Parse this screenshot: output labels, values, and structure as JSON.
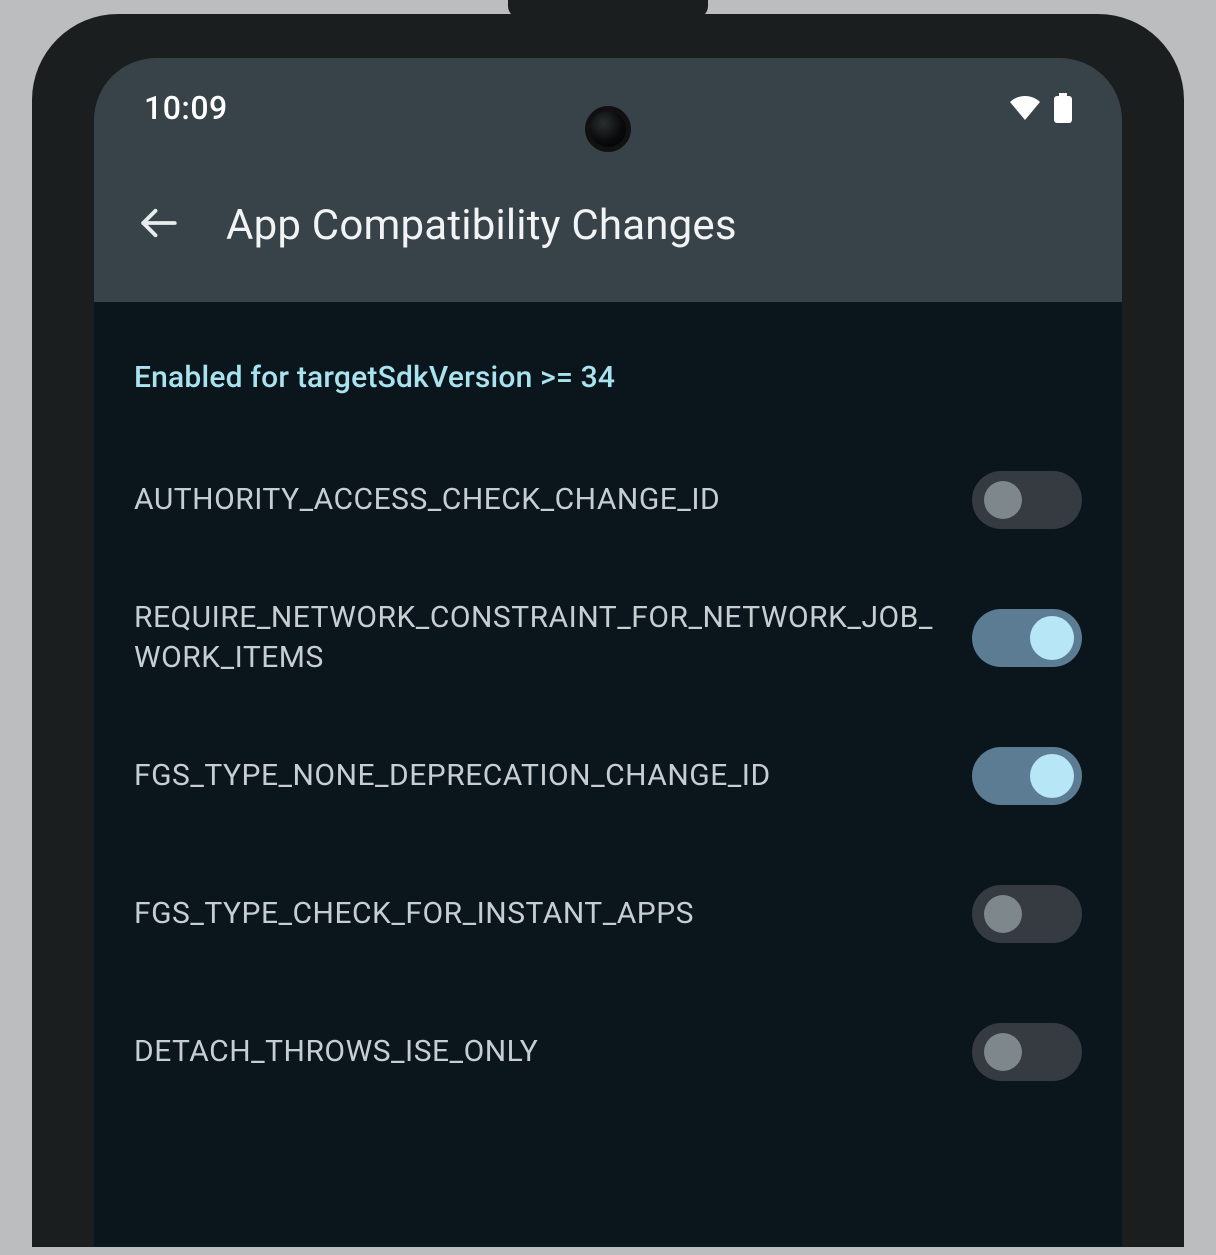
{
  "status": {
    "time": "10:09",
    "wifi_icon": "wifi-icon",
    "battery_icon": "battery-icon"
  },
  "header": {
    "title": "App Compatibility Changes"
  },
  "section": {
    "header": "Enabled for targetSdkVersion >= 34"
  },
  "settings": [
    {
      "label": "AUTHORITY_ACCESS_CHECK_CHANGE_ID",
      "enabled": false
    },
    {
      "label": "REQUIRE_NETWORK_CONSTRAINT_FOR_NETWORK_JOB_WORK_ITEMS",
      "enabled": true
    },
    {
      "label": "FGS_TYPE_NONE_DEPRECATION_CHANGE_ID",
      "enabled": true
    },
    {
      "label": "FGS_TYPE_CHECK_FOR_INSTANT_APPS",
      "enabled": false
    },
    {
      "label": "DETACH_THROWS_ISE_ONLY",
      "enabled": false
    }
  ]
}
